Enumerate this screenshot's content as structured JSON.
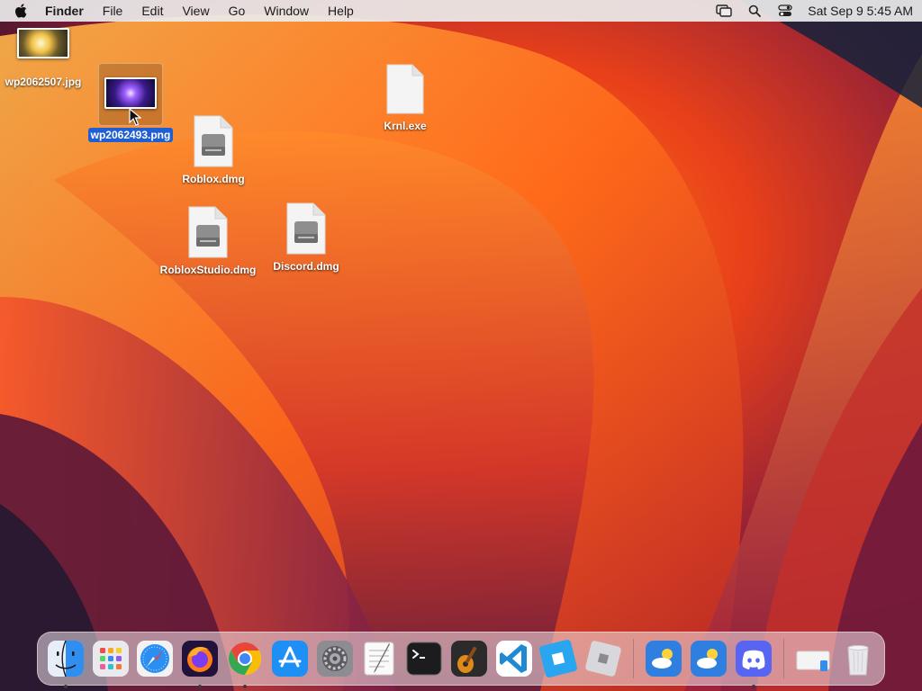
{
  "menubar": {
    "app_name": "Finder",
    "items": [
      "File",
      "Edit",
      "View",
      "Go",
      "Window",
      "Help"
    ],
    "clock": "Sat Sep 9  5:45 AM"
  },
  "desktop": {
    "files": [
      {
        "name": "wp2062507.jpg",
        "kind": "image",
        "selected": false
      },
      {
        "name": "wp2062493.png",
        "kind": "image",
        "selected": true
      },
      {
        "name": "Krnl.exe",
        "kind": "blank-document",
        "selected": false
      },
      {
        "name": "Roblox.dmg",
        "kind": "disk-image",
        "selected": false
      },
      {
        "name": "RobloxStudio.dmg",
        "kind": "disk-image",
        "selected": false
      },
      {
        "name": "Discord.dmg",
        "kind": "disk-image",
        "selected": false
      }
    ]
  },
  "dock": {
    "apps": [
      {
        "id": "finder",
        "running": true
      },
      {
        "id": "launchpad",
        "running": false
      },
      {
        "id": "safari",
        "running": false
      },
      {
        "id": "firefox",
        "running": true
      },
      {
        "id": "chrome",
        "running": true
      },
      {
        "id": "app-store",
        "running": false
      },
      {
        "id": "system-settings",
        "running": false
      },
      {
        "id": "textedit",
        "running": false
      },
      {
        "id": "terminal",
        "running": false
      },
      {
        "id": "garageband",
        "running": false
      },
      {
        "id": "vscode",
        "running": false
      },
      {
        "id": "roblox-studio",
        "running": false
      },
      {
        "id": "roblox",
        "running": false
      }
    ],
    "recent_apps": [
      {
        "id": "weather",
        "running": false
      },
      {
        "id": "weather-2",
        "running": false
      },
      {
        "id": "discord",
        "running": true
      }
    ],
    "trailing": [
      {
        "id": "downloads-stack"
      },
      {
        "id": "trash"
      }
    ]
  },
  "colors": {
    "selection": "#1f5fd3",
    "menubar": "#ececec"
  }
}
